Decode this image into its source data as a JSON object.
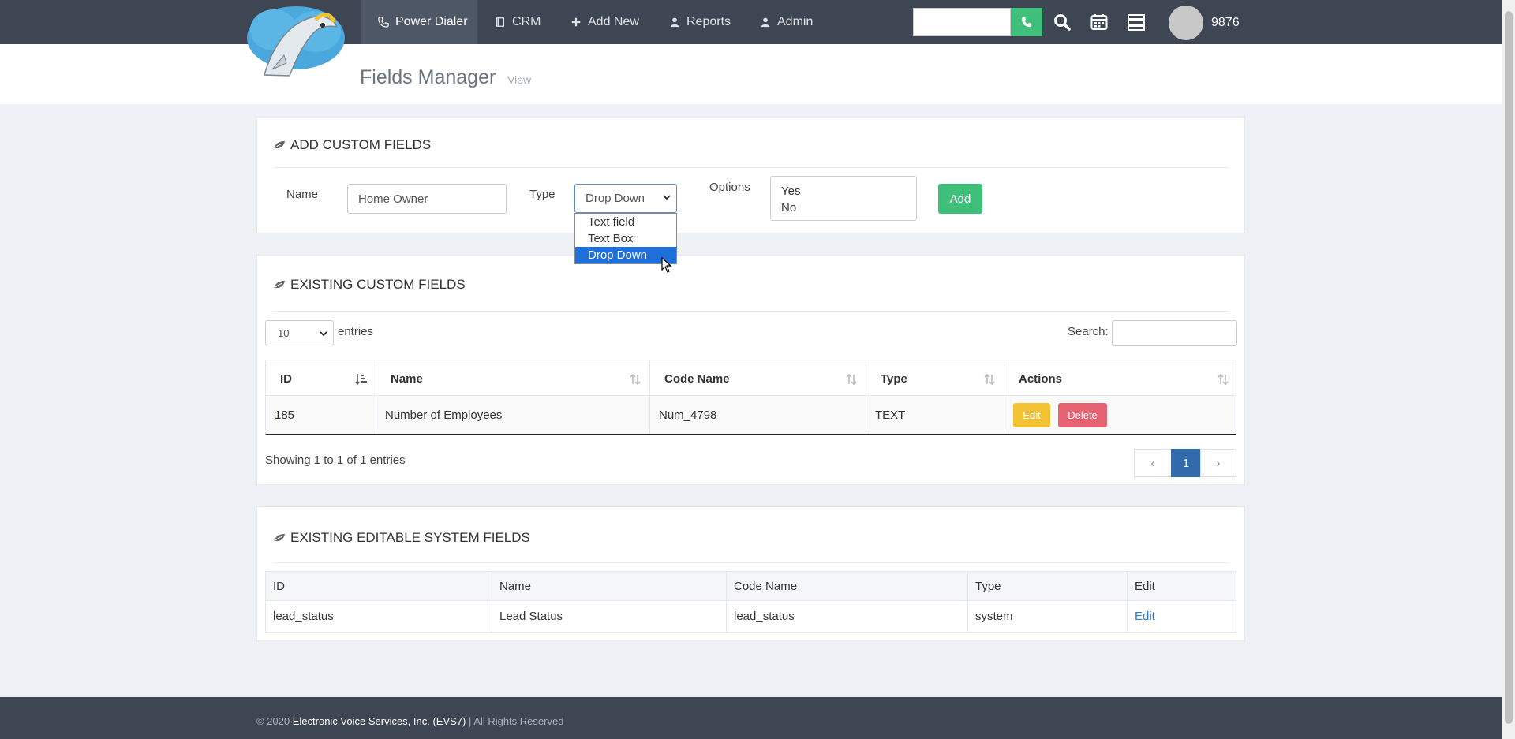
{
  "nav": {
    "items": [
      {
        "label": "Power Dialer",
        "icon": "phone-handset-icon"
      },
      {
        "label": "CRM",
        "icon": "book-icon"
      },
      {
        "label": "Add New",
        "icon": "plus-icon"
      },
      {
        "label": "Reports",
        "icon": "user-icon"
      },
      {
        "label": "Admin",
        "icon": "user-icon"
      }
    ],
    "extension": "9876"
  },
  "page": {
    "title": "Fields Manager",
    "subtitle": "View"
  },
  "add_panel": {
    "title": "ADD CUSTOM FIELDS",
    "name_label": "Name",
    "name_value": "Home Owner",
    "type_label": "Type",
    "type_value": "Drop Down",
    "type_options": [
      "Text field",
      "Text Box",
      "Drop Down"
    ],
    "options_label": "Options",
    "options_values": [
      "Yes",
      "No"
    ],
    "add_label": "Add"
  },
  "existing_panel": {
    "title": "EXISTING CUSTOM FIELDS",
    "entries_value": "10",
    "entries_label": "entries",
    "search_label": "Search:",
    "columns": [
      "ID",
      "Name",
      "Code Name",
      "Type",
      "Actions"
    ],
    "rows": [
      {
        "id": "185",
        "name": "Number of Employees",
        "code": "Num_4798",
        "type": "TEXT"
      }
    ],
    "edit_label": "Edit",
    "delete_label": "Delete",
    "info": "Showing 1 to 1 of 1 entries",
    "pager": {
      "prev": "‹",
      "current": "1",
      "next": "›"
    }
  },
  "system_panel": {
    "title": "EXISTING EDITABLE SYSTEM FIELDS",
    "columns": [
      "ID",
      "Name",
      "Code Name",
      "Type",
      "Edit"
    ],
    "rows": [
      {
        "id": "lead_status",
        "name": "Lead Status",
        "code": "lead_status",
        "type": "system",
        "edit": "Edit"
      }
    ]
  },
  "footer": {
    "copyright": "© 2020 ",
    "company": "Electronic Voice Services, Inc. (EVS7)",
    "rights": " | All Rights Reserved"
  },
  "colors": {
    "nav_bg": "#3d4652",
    "accent_green": "#3fbf7a",
    "edit_yellow": "#f0c234",
    "delete_red": "#e56373",
    "pager_blue": "#336aab",
    "link_blue": "#2a7ad6"
  }
}
